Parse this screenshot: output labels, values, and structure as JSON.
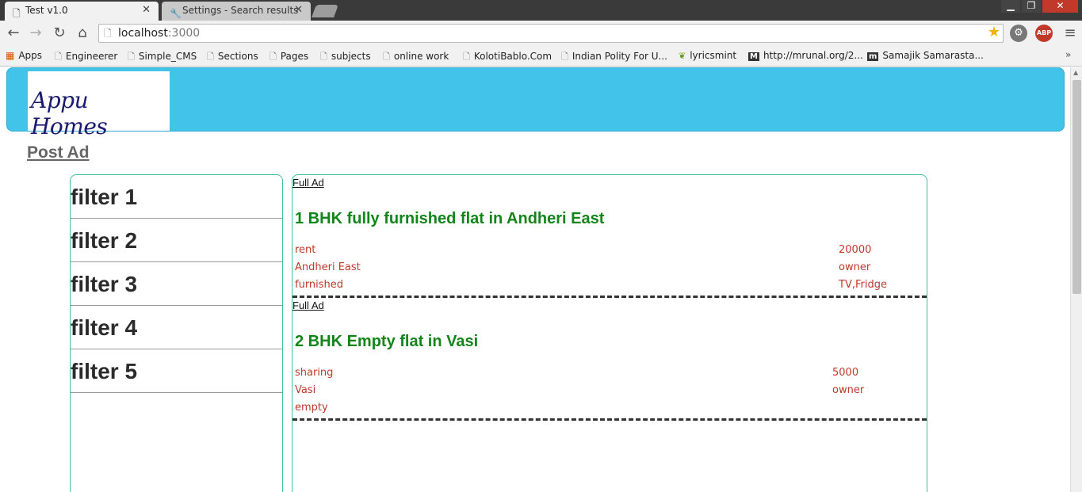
{
  "browser": {
    "tabs": [
      {
        "title": "Test v1.0",
        "active": true
      },
      {
        "title": "Settings - Search results",
        "active": false
      }
    ],
    "url_host": "localhost",
    "url_port": ":3000",
    "extensions": {
      "abp": "ABP"
    },
    "bookmarks": [
      {
        "label": "Apps",
        "icon": "apps-grid-icon"
      },
      {
        "label": "Engineerer",
        "icon": "page-icon"
      },
      {
        "label": "Simple_CMS",
        "icon": "page-icon"
      },
      {
        "label": "Sections",
        "icon": "page-icon"
      },
      {
        "label": "Pages",
        "icon": "page-icon"
      },
      {
        "label": "subjects",
        "icon": "page-icon"
      },
      {
        "label": "online work",
        "icon": "page-icon"
      },
      {
        "label": "KolotiBablo.Com",
        "icon": "page-icon"
      },
      {
        "label": "Indian Polity For U...",
        "icon": "page-icon"
      },
      {
        "label": "lyricsmint",
        "icon": "leaf-icon"
      },
      {
        "label": "http://mrunal.org/2...",
        "icon": "m-favicon-icon"
      },
      {
        "label": "Samajik Samarasta...",
        "icon": "m-favicon-icon"
      }
    ]
  },
  "page": {
    "logo_text": "Appu Homes",
    "post_ad_label": "Post Ad",
    "filters": [
      "filter 1",
      "filter 2",
      "filter 3",
      "filter 4",
      "filter 5"
    ],
    "ads": [
      {
        "link_label": "Full Ad",
        "title": "1 BHK fully furnished flat in Andheri East",
        "left_fields": [
          "rent",
          "Andheri East",
          "furnished"
        ],
        "right_fields": [
          "20000",
          "owner",
          "TV,Fridge"
        ]
      },
      {
        "link_label": "Full Ad",
        "title": "2 BHK Empty flat in Vasi",
        "left_fields": [
          "sharing",
          "Vasi",
          "empty"
        ],
        "right_fields": [
          "5000",
          "owner"
        ]
      }
    ]
  },
  "colors": {
    "header_band": "#42c3ea",
    "panel_border": "#3cc0a0",
    "ad_title": "#12851a",
    "ad_field": "#c0392b"
  }
}
